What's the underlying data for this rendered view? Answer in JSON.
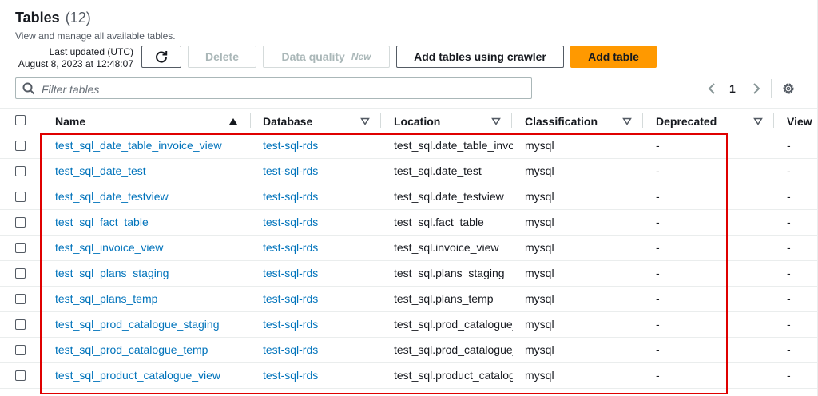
{
  "header": {
    "title": "Tables",
    "count": "(12)",
    "subtitle": "View and manage all available tables.",
    "last_updated_label": "Last updated (UTC)",
    "last_updated_value": "August 8, 2023 at 12:48:07"
  },
  "toolbar": {
    "refresh_icon": "refresh-icon",
    "delete_label": "Delete",
    "data_quality_label": "Data quality",
    "data_quality_badge": "New",
    "add_crawler_label": "Add tables using crawler",
    "add_table_label": "Add table"
  },
  "search": {
    "placeholder": "Filter tables"
  },
  "pagination": {
    "current_page": "1"
  },
  "columns": [
    "Name",
    "Database",
    "Location",
    "Classification",
    "Deprecated",
    "View"
  ],
  "rows": [
    {
      "name": "test_sql_date_table_invoice_view",
      "database": "test-sql-rds",
      "location": "test_sql.date_table_invoice_view",
      "classification": "mysql",
      "deprecated": "-",
      "view": "-"
    },
    {
      "name": "test_sql_date_test",
      "database": "test-sql-rds",
      "location": "test_sql.date_test",
      "classification": "mysql",
      "deprecated": "-",
      "view": "-"
    },
    {
      "name": "test_sql_date_testview",
      "database": "test-sql-rds",
      "location": "test_sql.date_testview",
      "classification": "mysql",
      "deprecated": "-",
      "view": "-"
    },
    {
      "name": "test_sql_fact_table",
      "database": "test-sql-rds",
      "location": "test_sql.fact_table",
      "classification": "mysql",
      "deprecated": "-",
      "view": "-"
    },
    {
      "name": "test_sql_invoice_view",
      "database": "test-sql-rds",
      "location": "test_sql.invoice_view",
      "classification": "mysql",
      "deprecated": "-",
      "view": "-"
    },
    {
      "name": "test_sql_plans_staging",
      "database": "test-sql-rds",
      "location": "test_sql.plans_staging",
      "classification": "mysql",
      "deprecated": "-",
      "view": "-"
    },
    {
      "name": "test_sql_plans_temp",
      "database": "test-sql-rds",
      "location": "test_sql.plans_temp",
      "classification": "mysql",
      "deprecated": "-",
      "view": "-"
    },
    {
      "name": "test_sql_prod_catalogue_staging",
      "database": "test-sql-rds",
      "location": "test_sql.prod_catalogue_staging",
      "classification": "mysql",
      "deprecated": "-",
      "view": "-"
    },
    {
      "name": "test_sql_prod_catalogue_temp",
      "database": "test-sql-rds",
      "location": "test_sql.prod_catalogue_temp",
      "classification": "mysql",
      "deprecated": "-",
      "view": "-"
    },
    {
      "name": "test_sql_product_catalogue_view",
      "database": "test-sql-rds",
      "location": "test_sql.product_catalogue_view",
      "classification": "mysql",
      "deprecated": "-",
      "view": "-"
    }
  ],
  "colors": {
    "link": "#0073bb",
    "primary": "#ff9900",
    "highlight": "#df0000"
  }
}
